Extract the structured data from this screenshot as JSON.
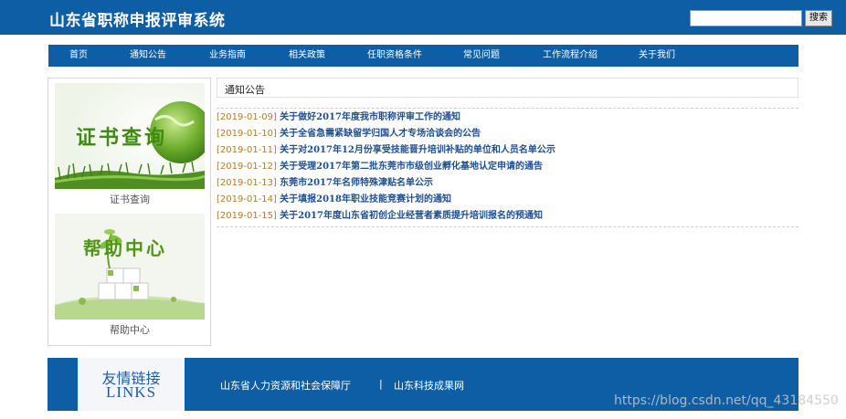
{
  "header": {
    "title": "山东省职称申报评审系统",
    "search_placeholder": "",
    "search_button": "搜索"
  },
  "nav": {
    "items": [
      {
        "label": "首页"
      },
      {
        "label": "通知公告"
      },
      {
        "label": "业务指南"
      },
      {
        "label": "相关政策"
      },
      {
        "label": "任职资格条件"
      },
      {
        "label": "常见问题"
      },
      {
        "label": "工作流程介绍"
      },
      {
        "label": "关于我们"
      }
    ]
  },
  "sidebar": {
    "cards": [
      {
        "image_text": "证书查询",
        "caption": "证书查询"
      },
      {
        "image_text": "帮助中心",
        "caption": "帮助中心"
      }
    ]
  },
  "notices": {
    "heading": "通知公告",
    "items": [
      {
        "date": "[2019-01-09]",
        "title": "关于做好2017年度我市职称评审工作的通知"
      },
      {
        "date": "[2019-01-10]",
        "title": "关于全省急需紧缺留学归国人才专场洽谈会的公告"
      },
      {
        "date": "[2019-01-11]",
        "title": "关于对2017年12月份享受技能晋升培训补贴的单位和人员名单公示"
      },
      {
        "date": "[2019-01-12]",
        "title": "关于受理2017年第二批东莞市市级创业孵化基地认定申请的通告"
      },
      {
        "date": "[2019-01-13]",
        "title": "东莞市2017年名师特殊津贴名单公示"
      },
      {
        "date": "[2019-01-14]",
        "title": "关于填报2018年职业技能竞赛计划的通知"
      },
      {
        "date": "[2019-01-15]",
        "title": "关于2017年度山东省初创企业经营者素质提升培训报名的预通知"
      }
    ]
  },
  "footer": {
    "links_title_cn": "友情链接",
    "links_title_en": "LINKS",
    "links": [
      {
        "label": "山东省人力资源和社会保障厅"
      },
      {
        "label": "山东科技成果网"
      }
    ],
    "separator": "|"
  },
  "watermark": "https://blog.csdn.net/qq_43184550",
  "colors": {
    "brand_blue": "#0d5ea4",
    "date_color": "#b47a2c",
    "link_color": "#1e4f8f"
  }
}
